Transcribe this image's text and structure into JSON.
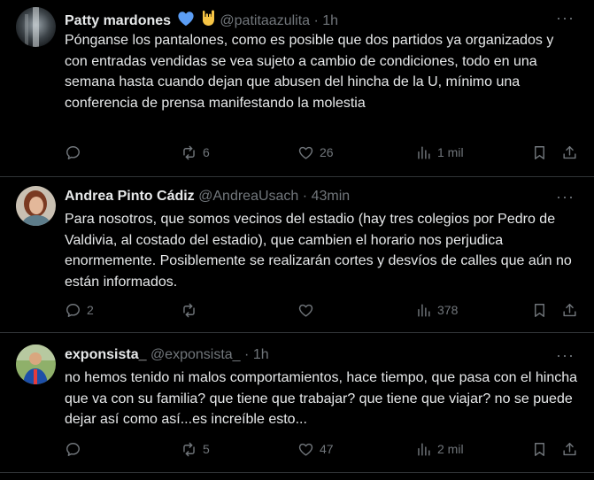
{
  "colors": {
    "background": "#000000",
    "text": "#e7e9ea",
    "muted": "#71767b",
    "divider": "#2f3336",
    "heart_emoji": "#5b9df4"
  },
  "tweets": [
    {
      "name": "Patty mardones",
      "badges": [
        "blue-heart-emoji",
        "rock-hand-emoji"
      ],
      "handle": "@patitaazulita",
      "dot": "·",
      "time": "1h",
      "more": "···",
      "text": "Pónganse los pantalones, como es posible que dos partidos ya organizados y con entradas vendidas se vea sujeto a cambio de condiciones, todo en una semana hasta cuando dejan que abusen del hincha de la U, mínimo una conferencia de prensa manifestando la molestia",
      "replies": "",
      "reposts": "6",
      "likes": "26",
      "views": "1 mil"
    },
    {
      "name": "Andrea Pinto Cádiz",
      "badges": [],
      "handle": "@AndreaUsach",
      "dot": "·",
      "time": "43min",
      "more": "···",
      "text": "Para nosotros, que somos vecinos del estadio (hay tres colegios por Pedro de Valdivia, al costado del estadio), que cambien el horario nos perjudica enormemente. Posiblemente se realizarán cortes y desvíos de calles que aún no están informados.",
      "replies": "2",
      "reposts": "",
      "likes": "",
      "views": "378"
    },
    {
      "name": "exponsista_",
      "badges": [],
      "handle": "@exponsista_",
      "dot": "·",
      "time": "1h",
      "more": "···",
      "text": "no hemos tenido ni malos comportamientos, hace tiempo, que pasa con el hincha que va con su familia? que tiene que trabajar? que tiene que viajar? no se puede dejar así como así...es increíble esto...",
      "replies": "",
      "reposts": "5",
      "likes": "47",
      "views": "2 mil"
    }
  ]
}
